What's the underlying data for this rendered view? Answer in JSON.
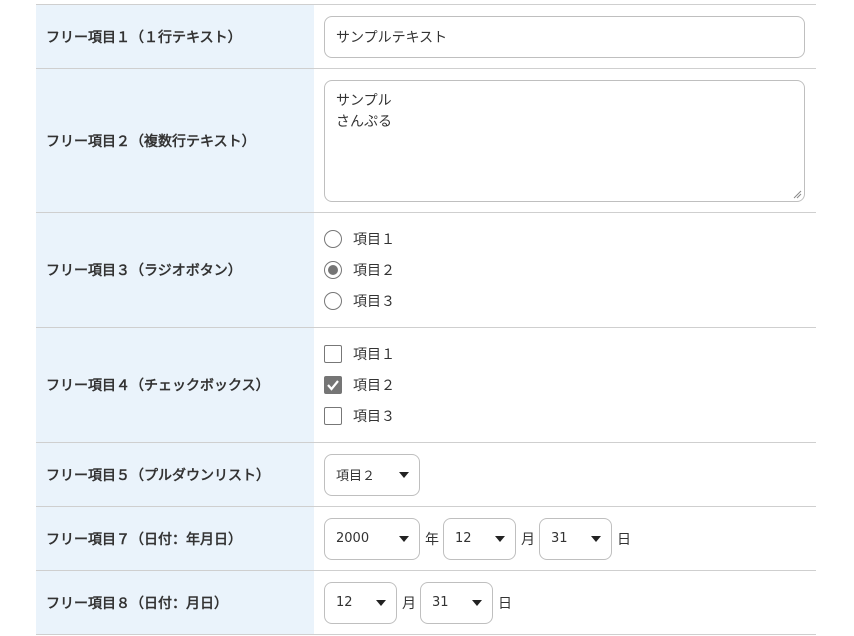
{
  "rows": {
    "free1": {
      "label": "フリー項目１（１行テキスト）",
      "value": "サンプルテキスト"
    },
    "free2": {
      "label": "フリー項目２（複数行テキスト）",
      "lines": [
        "サンプル",
        "さんぷる"
      ]
    },
    "free3": {
      "label": "フリー項目３（ラジオボタン）",
      "options": [
        "項目１",
        "項目２",
        "項目３"
      ],
      "selected_index": 1
    },
    "free4": {
      "label": "フリー項目４（チェックボックス）",
      "options": [
        "項目１",
        "項目２",
        "項目３"
      ],
      "checked": [
        false,
        true,
        false
      ]
    },
    "free5": {
      "label": "フリー項目５（プルダウンリスト）",
      "selected": "項目２"
    },
    "free7": {
      "label": "フリー項目７（日付：年月日）",
      "year": "2000",
      "year_unit": "年",
      "month": "12",
      "month_unit": "月",
      "day": "31",
      "day_unit": "日"
    },
    "free8": {
      "label": "フリー項目８（日付：月日）",
      "month": "12",
      "month_unit": "月",
      "day": "31",
      "day_unit": "日"
    }
  },
  "colors": {
    "label_bg": "#eaf3fb",
    "border": "#cfcfcf",
    "checked_fill": "#757575"
  },
  "icons": {
    "select_caret": "caret-down-icon",
    "check": "check-icon",
    "resize": "resize-grip-icon"
  }
}
